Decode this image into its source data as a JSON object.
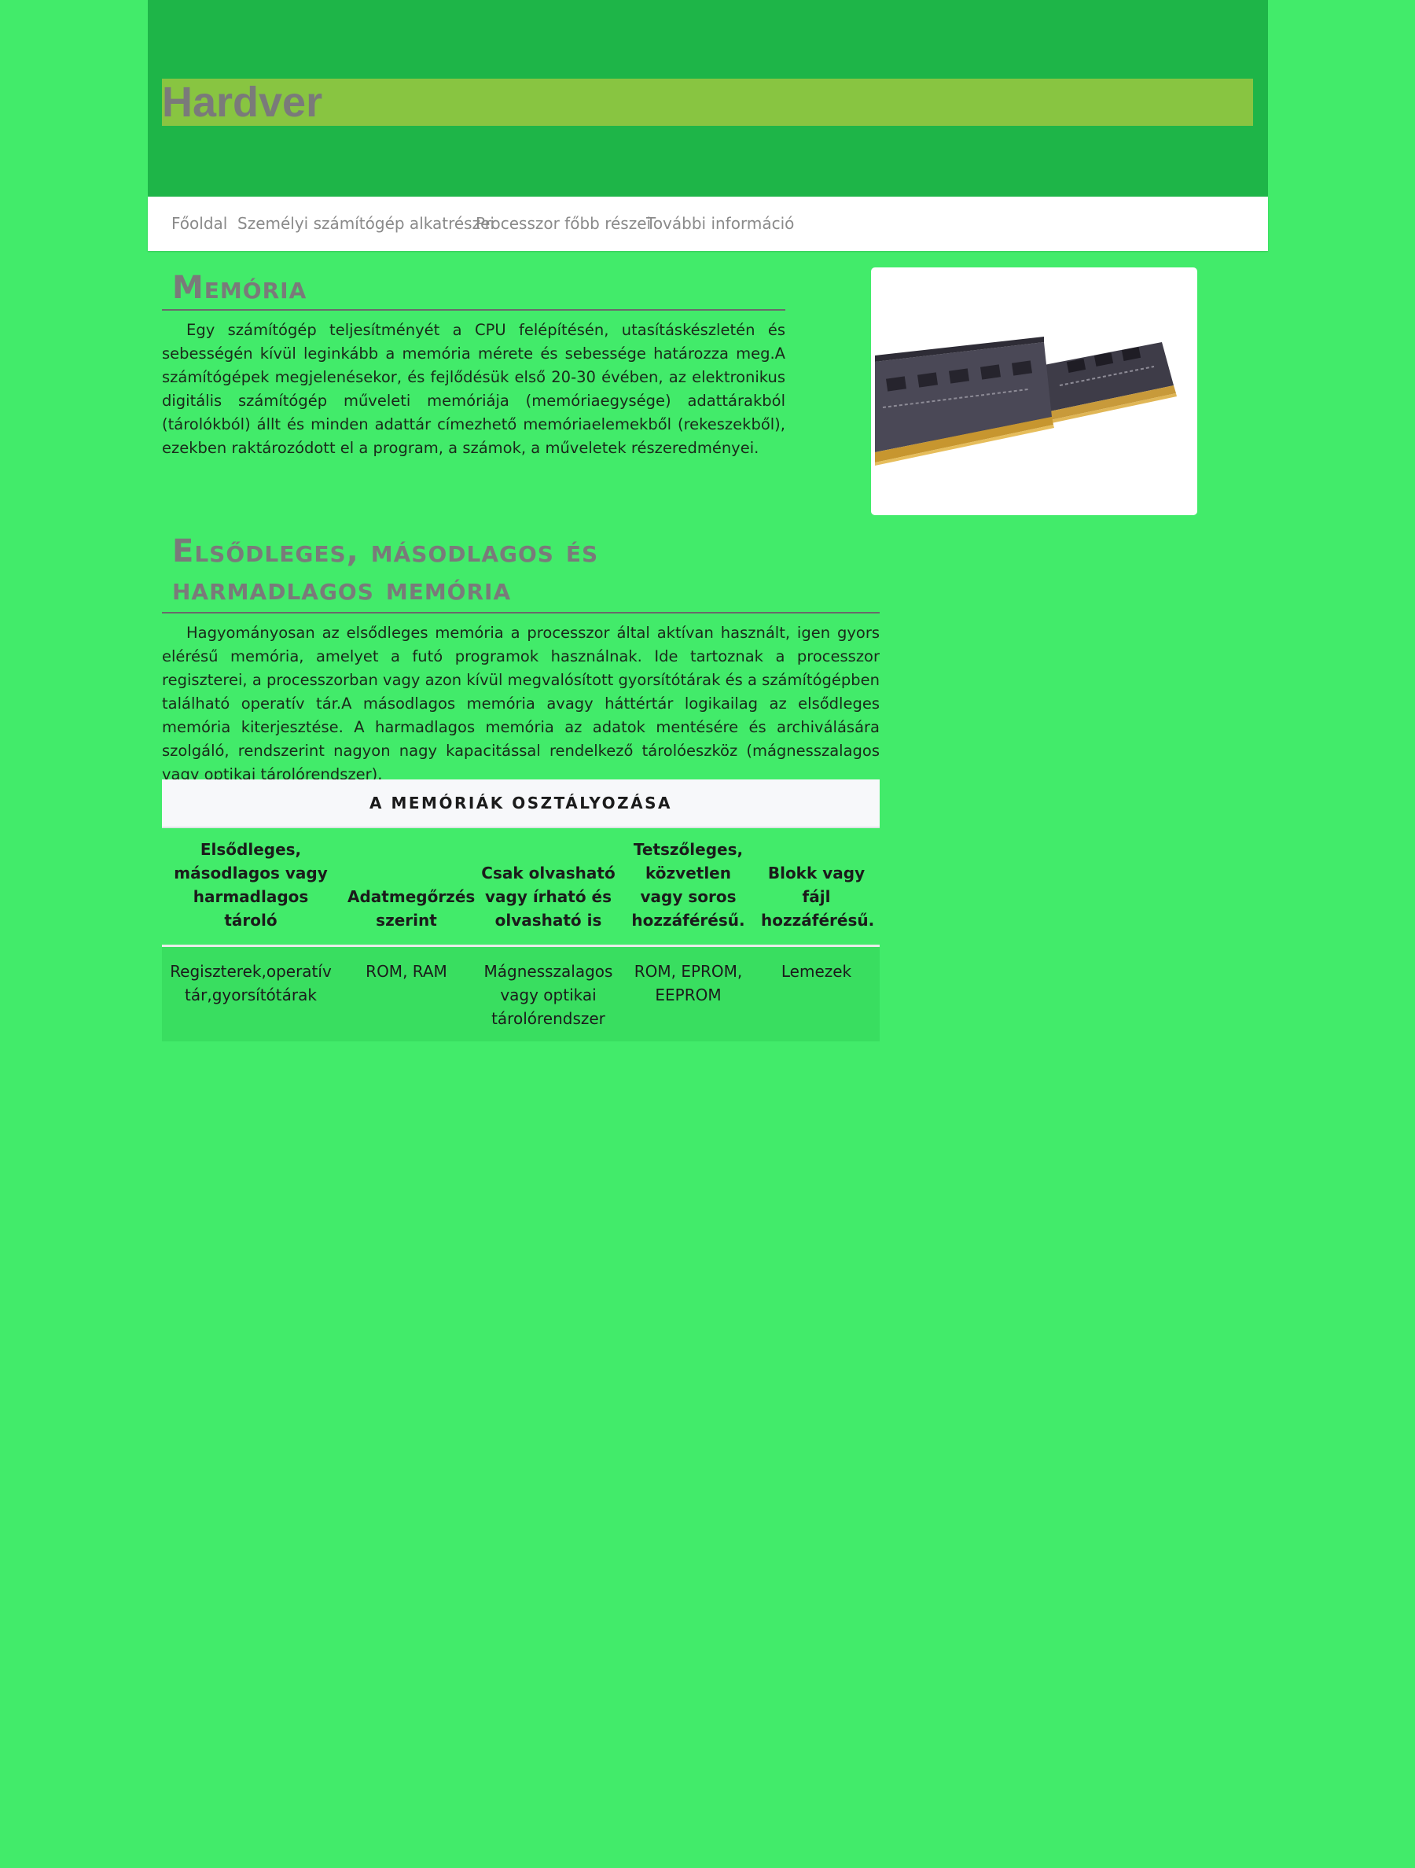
{
  "header": {
    "title": "Hardver"
  },
  "nav": {
    "items": [
      {
        "label": "Főoldal"
      },
      {
        "label": "Személyi számítógép alkatrészei"
      },
      {
        "label": "Processzor főbb részei"
      },
      {
        "label": "További információ"
      }
    ]
  },
  "section1": {
    "title": "Memória",
    "text": "Egy számítógép teljesítményét a CPU felépítésén, utasításkészletén és sebességén kívül leginkább a memória mérete és sebessége határozza meg.A számítógépek megjelenésekor, és fejlődésük első 20-30 évében, az elektronikus digitális számítógép műveleti memóriája (memóriaegysége) adattárakból (tárolókból) állt és minden adattár címezhető memóriaelemekből (rekeszekből), ezekben raktározódott el a program, a számok, a műveletek részeredményei."
  },
  "image": {
    "icon": "ram-module-image"
  },
  "section2": {
    "title": "Elsődleges, másodlagos és harmadlagos memória",
    "text": "Hagyományosan az elsődleges memória a processzor által aktívan használt, igen gyors elérésű memória, amelyet a futó programok használnak. Ide tartoznak a processzor regiszterei, a processzorban vagy azon kívül megvalósított gyorsítótárak és a számítógépben található operatív tár.A másodlagos memória avagy háttértár logikailag az elsődleges memória kiterjesztése. A harmadlagos memória az adatok mentésére és archiválására szolgáló, rendszerint nagyon nagy kapacitással rendelkező tárolóeszköz (mágnesszalagos vagy optikai tárolórendszer)."
  },
  "table": {
    "caption": "A memóriák osztályozása",
    "headers": [
      "Elsődleges, másodlagos vagy harmadlagos tároló",
      "Adatmegőrzés szerint",
      "Csak olvasható vagy írható és olvasható is",
      "Tetszőleges, közvetlen vagy soros hozzáférésű.",
      "Blokk vagy fájl hozzáférésű."
    ],
    "rows": [
      [
        "Regiszterek,operatív tár,gyorsítótárak",
        "ROM, RAM",
        "Mágnesszalagos vagy optikai tárolórendszer",
        "ROM, EPROM, EEPROM",
        "Lemezek"
      ]
    ]
  }
}
